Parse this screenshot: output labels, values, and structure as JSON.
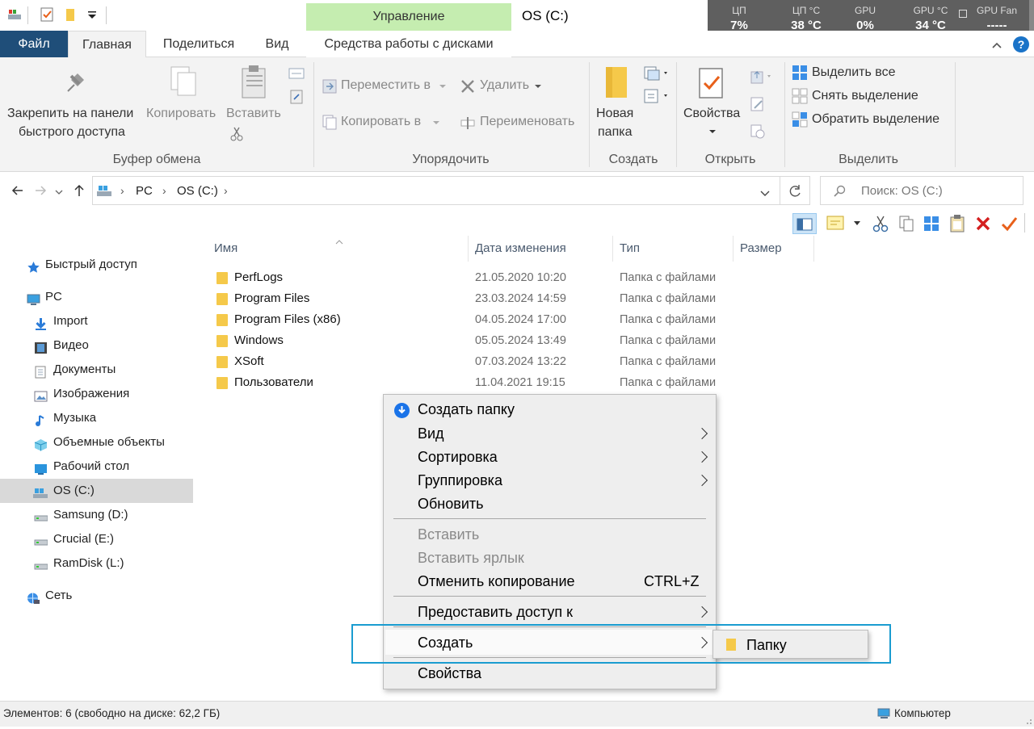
{
  "title_bar": {
    "context_group": "Управление",
    "window_title": "OS (C:)"
  },
  "hw_monitor": {
    "cols": [
      {
        "label": "ЦП",
        "value": "7%"
      },
      {
        "label": "ЦП °C",
        "value": "38 °C"
      },
      {
        "label": "GPU",
        "value": "0%"
      },
      {
        "label": "GPU °C",
        "value": "34 °C"
      },
      {
        "label": "GPU Fan",
        "value": "-----"
      }
    ]
  },
  "tabs": {
    "file": "Файл",
    "home": "Главная",
    "share": "Поделиться",
    "view": "Вид",
    "disk_tools": "Средства работы с дисками"
  },
  "ribbon": {
    "clipboard": {
      "pin_line1": "Закрепить на панели",
      "pin_line2": "быстрого доступа",
      "copy": "Копировать",
      "paste": "Вставить",
      "label": "Буфер обмена"
    },
    "organize": {
      "move_to": "Переместить в",
      "copy_to": "Копировать в",
      "delete": "Удалить",
      "rename": "Переименовать",
      "label": "Упорядочить"
    },
    "create": {
      "new_folder_line1": "Новая",
      "new_folder_line2": "папка",
      "label": "Создать"
    },
    "open": {
      "properties": "Свойства",
      "label": "Открыть"
    },
    "select": {
      "select_all": "Выделить все",
      "select_none": "Снять выделение",
      "invert": "Обратить выделение",
      "label": "Выделить"
    }
  },
  "address": {
    "crumbs": [
      "PC",
      "OS (C:)"
    ],
    "search_placeholder": "Поиск: OS (C:)"
  },
  "nav": {
    "items": [
      {
        "label": "Быстрый доступ",
        "icon": "star-icon"
      },
      {
        "label": "PC",
        "icon": "computer-icon"
      },
      {
        "label": "Import",
        "icon": "download-arrow-icon"
      },
      {
        "label": "Видео",
        "icon": "film-icon"
      },
      {
        "label": "Документы",
        "icon": "document-icon"
      },
      {
        "label": "Изображения",
        "icon": "picture-icon"
      },
      {
        "label": "Музыка",
        "icon": "music-note-icon"
      },
      {
        "label": "Объемные объекты",
        "icon": "cube-icon"
      },
      {
        "label": "Рабочий стол",
        "icon": "desktop-icon"
      },
      {
        "label": "OS (C:)",
        "icon": "system-drive-icon"
      },
      {
        "label": "Samsung (D:)",
        "icon": "drive-icon"
      },
      {
        "label": "Crucial (E:)",
        "icon": "drive-icon"
      },
      {
        "label": "RamDisk (L:)",
        "icon": "drive-icon"
      },
      {
        "label": "Сеть",
        "icon": "network-icon"
      }
    ],
    "selected": "OS (C:)"
  },
  "file_list": {
    "columns": [
      "Имя",
      "Дата изменения",
      "Тип",
      "Размер"
    ],
    "rows": [
      {
        "name": "PerfLogs",
        "date": "21.05.2020 10:20",
        "type": "Папка с файлами"
      },
      {
        "name": "Program Files",
        "date": "23.03.2024 14:59",
        "type": "Папка с файлами"
      },
      {
        "name": "Program Files (x86)",
        "date": "04.05.2024 17:00",
        "type": "Папка с файлами"
      },
      {
        "name": "Windows",
        "date": "05.05.2024 13:49",
        "type": "Папка с файлами"
      },
      {
        "name": "XSoft",
        "date": "07.03.2024 13:22",
        "type": "Папка с файлами"
      },
      {
        "name": "Пользователи",
        "date": "11.04.2021 19:15",
        "type": "Папка с файлами"
      }
    ]
  },
  "context_menu": {
    "create_folder": "Создать папку",
    "view": "Вид",
    "sort": "Сортировка",
    "group": "Группировка",
    "refresh": "Обновить",
    "paste": "Вставить",
    "paste_shortcut": "Вставить ярлык",
    "undo_copy": "Отменить копирование",
    "undo_copy_shortcut": "CTRL+Z",
    "share_with": "Предоставить доступ к",
    "new": "Создать",
    "properties": "Свойства"
  },
  "submenu": {
    "folder": "Папку"
  },
  "status": {
    "items": "Элементов: 6 (свободно на диске: 62,2 ГБ)",
    "computer": "Компьютер"
  },
  "colors": {
    "file_tab": "#1f4e79",
    "manage_band": "#c5edb0",
    "highlight": "#1a9cd0",
    "folder": "#f5c94a"
  }
}
